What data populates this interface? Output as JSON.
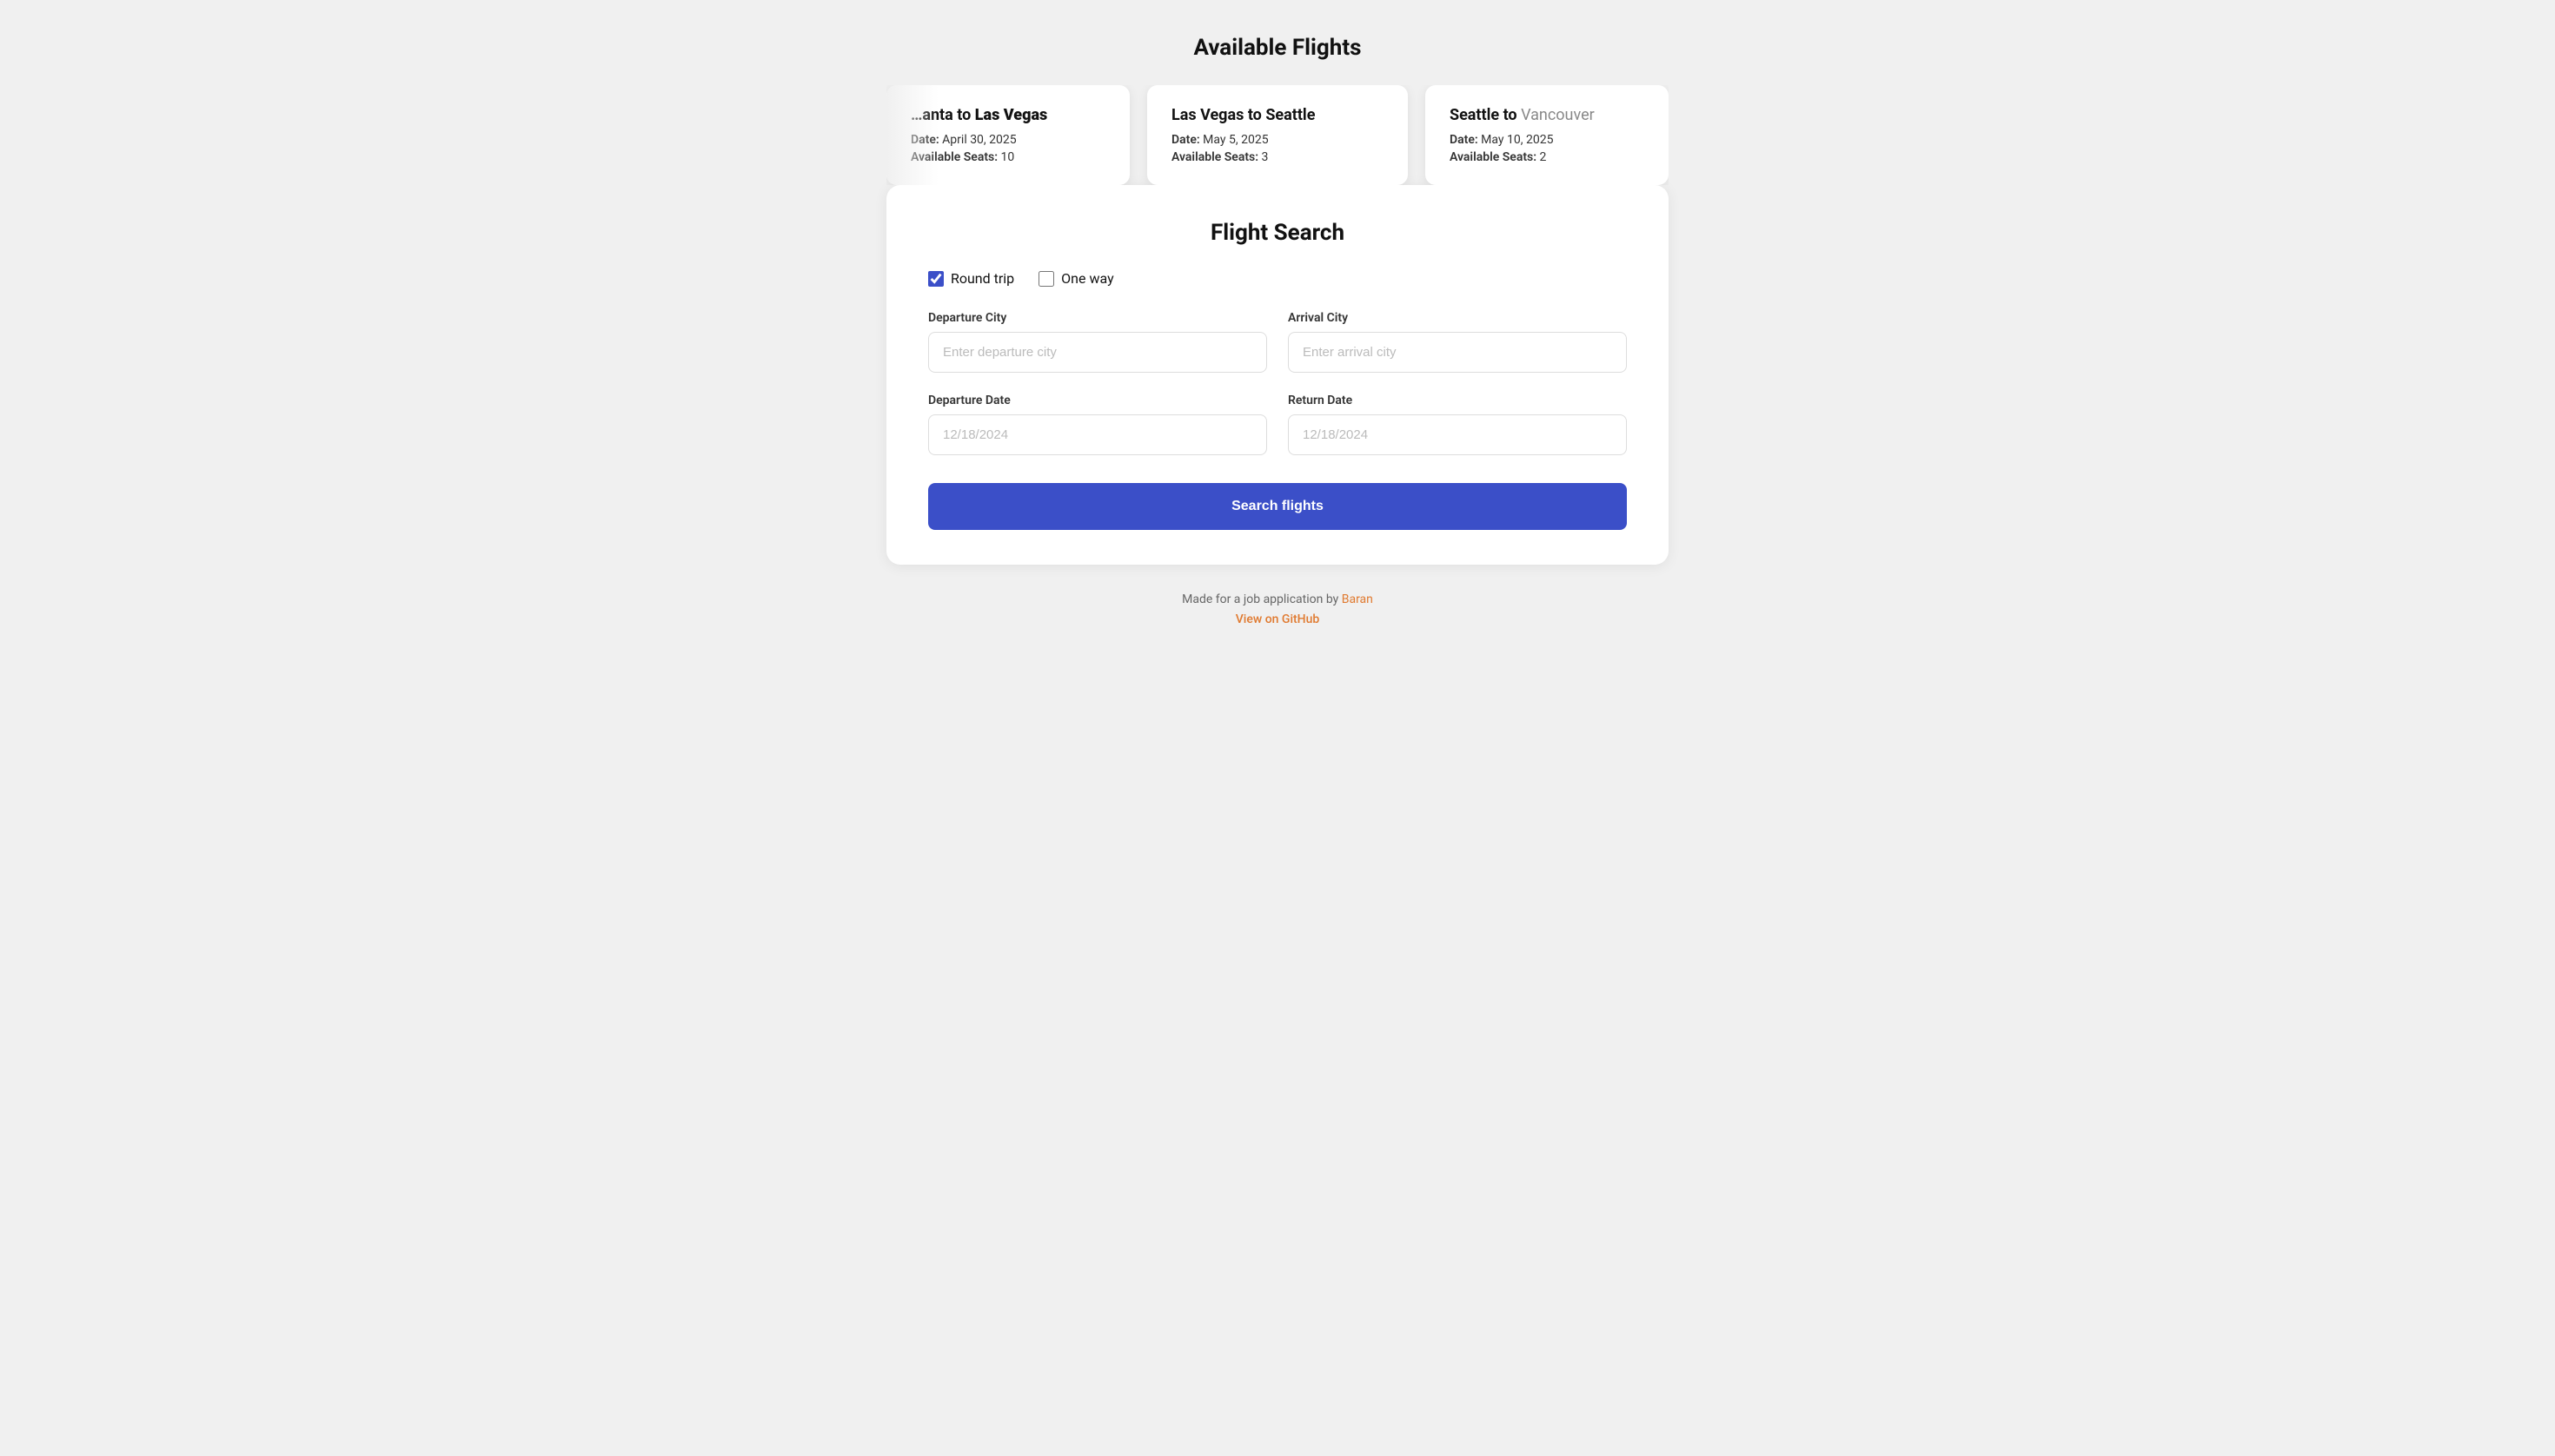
{
  "page": {
    "flights_title": "Available Flights",
    "flight_search_title": "Flight Search"
  },
  "flights": [
    {
      "id": "flight-1",
      "origin": "…anta",
      "origin_dim": false,
      "destination": "Las Vegas",
      "destination_dim": false,
      "date_label": "Date:",
      "date_value": "April 30, 2025",
      "seats_label": "Available Seats:",
      "seats_value": "10",
      "partial": "left"
    },
    {
      "id": "flight-2",
      "origin": "Las Vegas",
      "origin_dim": false,
      "destination": "Seattle",
      "destination_dim": false,
      "date_label": "Date:",
      "date_value": "May 5, 2025",
      "seats_label": "Available Seats:",
      "seats_value": "3",
      "partial": "none"
    },
    {
      "id": "flight-3",
      "origin": "Seattle",
      "origin_dim": false,
      "destination": "Vancouver",
      "destination_dim": true,
      "date_label": "Date:",
      "date_value": "May 10, 2025",
      "seats_label": "Available Seats:",
      "seats_value": "2",
      "partial": "right"
    }
  ],
  "search": {
    "trip_types": [
      {
        "id": "round-trip",
        "label": "Round trip",
        "checked": true
      },
      {
        "id": "one-way",
        "label": "One way",
        "checked": false
      }
    ],
    "departure_city": {
      "label": "Departure City",
      "placeholder": "Enter departure city"
    },
    "arrival_city": {
      "label": "Arrival City",
      "placeholder": "Enter arrival city"
    },
    "departure_date": {
      "label": "Departure Date",
      "value": "12/18/2024"
    },
    "return_date": {
      "label": "Return Date",
      "value": "12/18/2024"
    },
    "search_button_label": "Search flights"
  },
  "footer": {
    "made_by_text": "Made for a job application by",
    "author_name": "Baran",
    "github_link_text": "View on GitHub"
  },
  "colors": {
    "accent_blue": "#3b4fc8",
    "accent_orange": "#e07a30",
    "dim_text": "#888888"
  }
}
